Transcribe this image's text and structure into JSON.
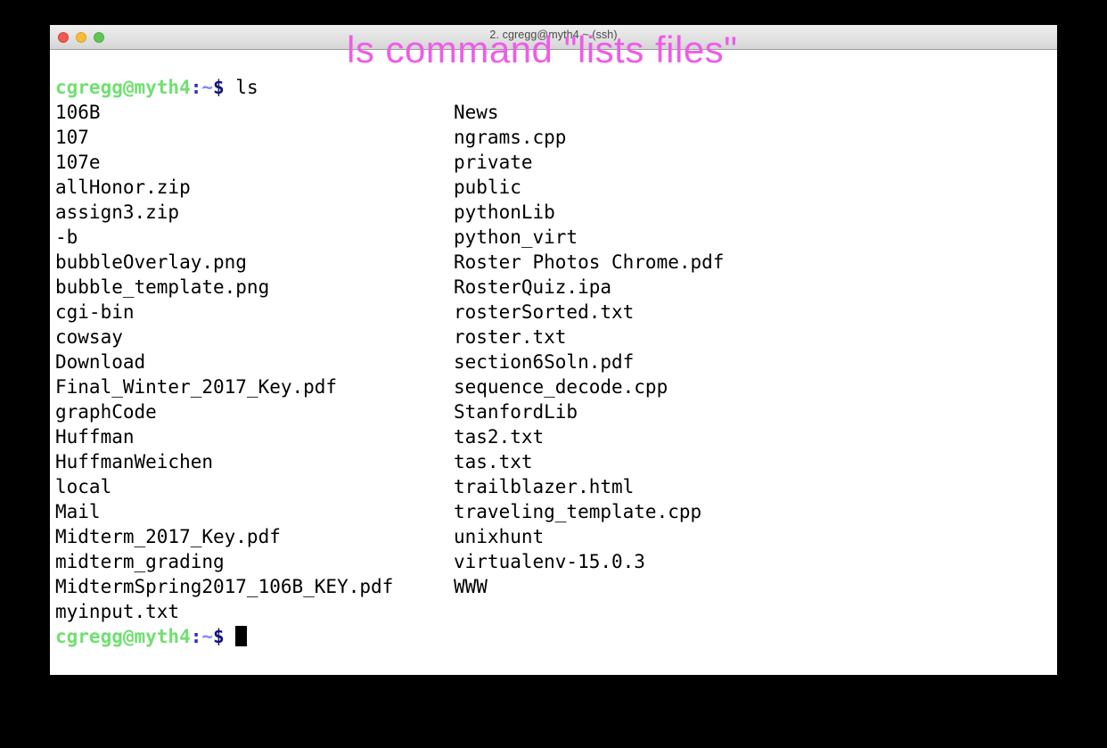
{
  "window": {
    "title": "2. cgregg@myth4  ~ (ssh)",
    "traffic_lights": {
      "close_label": "close",
      "minimize_label": "minimize",
      "maximize_label": "maximize"
    }
  },
  "annotation": {
    "text": "ls command \"lists files\"",
    "color": "#ee5ce8"
  },
  "terminal": {
    "prompt": {
      "user_host": "cgregg@myth4",
      "colon": ":",
      "tilde": "~",
      "dollar": "$",
      "colors": {
        "user_host": "#70e070",
        "colon": "#2b2bd4",
        "tilde": "#7d8cf0",
        "dollar": "#11117a",
        "text": "#000000",
        "background": "#ffffff"
      }
    },
    "command": "ls",
    "ls_output": {
      "column_1": [
        "106B",
        "107",
        "107e",
        "allHonor.zip",
        "assign3.zip",
        "-b",
        "bubbleOverlay.png",
        "bubble_template.png",
        "cgi-bin",
        "cowsay",
        "Download",
        "Final_Winter_2017_Key.pdf",
        "graphCode",
        "Huffman",
        "HuffmanWeichen",
        "local",
        "Mail",
        "Midterm_2017_Key.pdf",
        "midterm_grading",
        "MidtermSpring2017_106B_KEY.pdf",
        "myinput.txt"
      ],
      "column_2": [
        "News",
        "ngrams.cpp",
        "private",
        "public",
        "pythonLib",
        "python_virt",
        "Roster Photos Chrome.pdf",
        "RosterQuiz.ipa",
        "rosterSorted.txt",
        "roster.txt",
        "section6Soln.pdf",
        "sequence_decode.cpp",
        "StanfordLib",
        "tas2.txt",
        "tas.txt",
        "trailblazer.html",
        "traveling_template.cpp",
        "unixhunt",
        "virtualenv-15.0.3",
        "WWW"
      ]
    }
  }
}
